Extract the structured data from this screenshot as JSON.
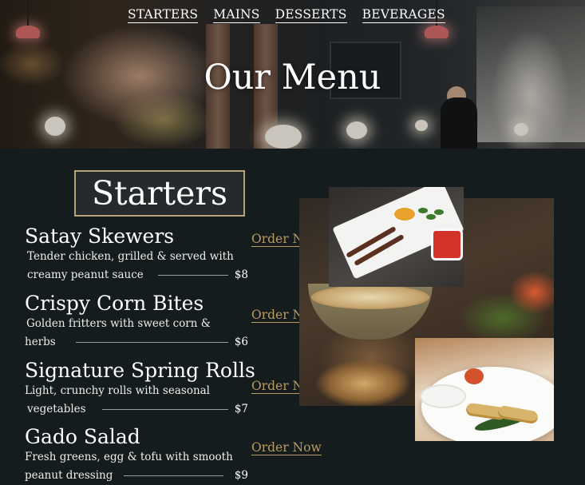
{
  "nav": {
    "items": [
      {
        "label": "STARTERS"
      },
      {
        "label": "MAINS"
      },
      {
        "label": "DESSERTS"
      },
      {
        "label": "BEVERAGES"
      }
    ]
  },
  "hero": {
    "title": "Our Menu"
  },
  "section": {
    "heading": "Starters"
  },
  "order_label": "Order Now",
  "menu_items": [
    {
      "name": "Satay Skewers",
      "desc_line1": "Tender chicken, grilled & served with",
      "desc_line2": "creamy peanut sauce",
      "price": "$8"
    },
    {
      "name": "Crispy Corn Bites",
      "desc_line1": "Golden fritters with sweet corn &",
      "desc_line2": "herbs",
      "price": "$6"
    },
    {
      "name": "Signature Spring Rolls",
      "desc_line1": "Light, crunchy rolls with seasonal",
      "desc_line2": "vegetables",
      "price": "$7"
    },
    {
      "name": "Gado Salad",
      "desc_line1": "Fresh greens, egg & tofu with smooth",
      "desc_line2": "peanut dressing",
      "price": "$9"
    }
  ]
}
